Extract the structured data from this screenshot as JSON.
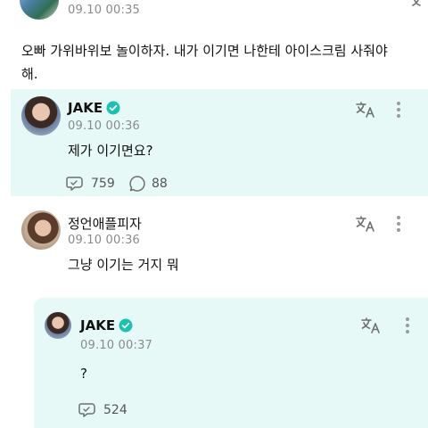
{
  "post_top": {
    "time": "09.10 00:35",
    "body": "오빠 가위바위보 놀이하자.  내가 이기면 나한테 아이스크림 사줘야 해."
  },
  "reply_jake_1": {
    "name": "JAKE",
    "time": "09.10 00:36",
    "body": "제가 이기면요?",
    "reply_count": "759",
    "comment_count": "88"
  },
  "comment_fan": {
    "name": "정언애플피자",
    "time": "09.10 00:36",
    "body": "그냥 이기는 거지 뭐"
  },
  "reply_jake_2": {
    "name": "JAKE",
    "time": "09.10 00:37",
    "body": "?",
    "reply_count": "524"
  },
  "colors": {
    "artist_panel_bg": "#e6f9f6",
    "verified_badge": "#18c3b0"
  }
}
